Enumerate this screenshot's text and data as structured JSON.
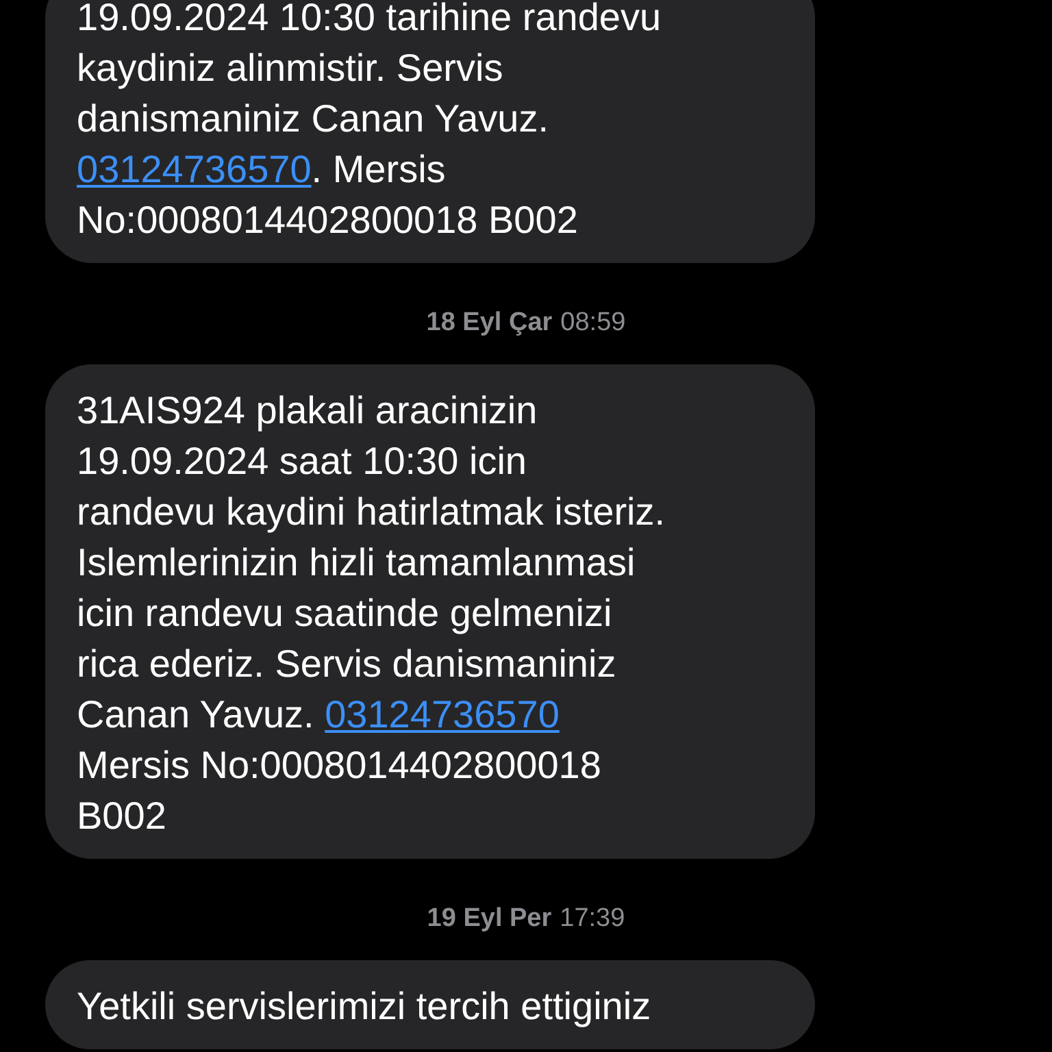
{
  "conversation": [
    {
      "kind": "message",
      "parts": [
        {
          "kind": "text",
          "text": "19.09.2024 10:30 tarihine randevu\nkaydiniz alinmistir. Servis\ndanismaniniz Canan Yavuz.\n"
        },
        {
          "kind": "link",
          "text": "03124736570"
        },
        {
          "kind": "text",
          "text": ". Mersis\nNo:0008014402800018 B002"
        }
      ]
    },
    {
      "kind": "timestamp",
      "day": "18 Eyl Çar",
      "time": "08:59"
    },
    {
      "kind": "message",
      "parts": [
        {
          "kind": "text",
          "text": "31AIS924 plakali aracinizin\n19.09.2024 saat 10:30 icin\nrandevu kaydini hatirlatmak isteriz.\nIslemlerinizin hizli tamamlanmasi\nicin randevu saatinde gelmenizi\nrica ederiz. Servis danismaniniz\nCanan Yavuz. "
        },
        {
          "kind": "link",
          "text": "03124736570"
        },
        {
          "kind": "text",
          "text": "\nMersis No:0008014402800018\nB002"
        }
      ]
    },
    {
      "kind": "timestamp",
      "day": "19 Eyl Per",
      "time": "17:39"
    },
    {
      "kind": "message",
      "parts": [
        {
          "kind": "text",
          "text": "Yetkili servislerimizi tercih ettiginiz"
        }
      ]
    }
  ]
}
